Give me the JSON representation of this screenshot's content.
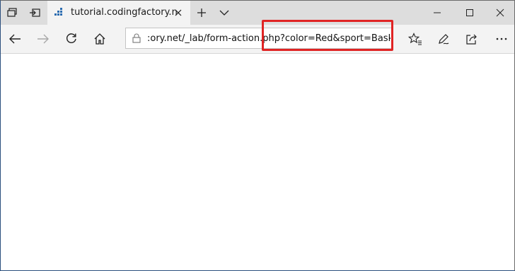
{
  "titlebar": {
    "tab": {
      "title": "tutorial.codingfactory.net"
    }
  },
  "navbar": {
    "address": {
      "url_prefix": ":ory.net/_lab/form-action.php",
      "url_query": "?color=Red&sport=Basketball"
    }
  },
  "colors": {
    "highlight": "#e02424",
    "favicon": "#2b6cb0",
    "tabbar": "#dddddd",
    "toolbar": "#f3f3f3"
  }
}
